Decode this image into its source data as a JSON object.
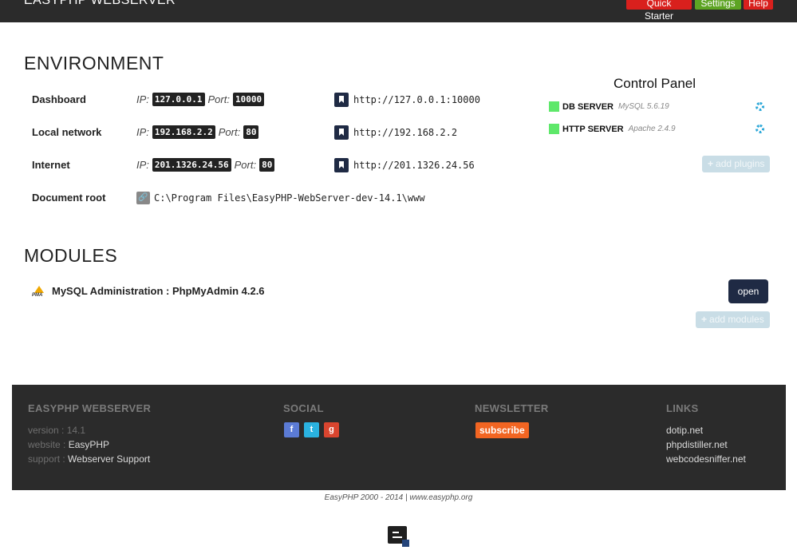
{
  "topbar": {
    "brand": "EASYPHP WEBSERVER",
    "quick_starter": "Quick Starter",
    "settings": "Settings",
    "help": "Help"
  },
  "environment": {
    "title": "ENVIRONMENT",
    "ip_label": "IP:",
    "port_label": "Port:",
    "rows": [
      {
        "label": "Dashboard",
        "ip": "127.0.0.1",
        "port": "10000",
        "url": "http://127.0.0.1:10000"
      },
      {
        "label": "Local network",
        "ip": "192.168.2.2",
        "port": "80",
        "url": "http://192.168.2.2"
      },
      {
        "label": "Internet",
        "ip": "201.1326.24.56",
        "port": "80",
        "url": "http://201.1326.24.56"
      }
    ],
    "docroot_label": "Document root",
    "docroot_path": "C:\\Program Files\\EasyPHP-WebServer-dev-14.1\\www"
  },
  "control_panel": {
    "title": "Control Panel",
    "servers": [
      {
        "name": "DB SERVER",
        "version": "MySQL 5.6.19",
        "status_color": "#5ee86a"
      },
      {
        "name": "HTTP SERVER",
        "version": "Apache 2.4.9",
        "status_color": "#5ee86a"
      }
    ],
    "add_plugins": "add plugins"
  },
  "modules": {
    "title": "MODULES",
    "items": [
      {
        "title": "MySQL Administration : PhpMyAdmin 4.2.6",
        "icon_text": "PMA",
        "action": "open"
      }
    ],
    "add_modules": "add modules"
  },
  "footer": {
    "col1": {
      "heading": "EASYPHP WEBSERVER",
      "version_label": "version :",
      "version_value": "14.1",
      "website_label": "website :",
      "website_value": "EasyPHP",
      "support_label": "support :",
      "support_value": "Webserver Support"
    },
    "social": {
      "heading": "SOCIAL",
      "facebook": "f",
      "twitter": "t",
      "google": "g"
    },
    "newsletter": {
      "heading": "NEWSLETTER",
      "subscribe": "subscribe"
    },
    "links": {
      "heading": "LINKS",
      "items": [
        "dotip.net",
        "phpdistiller.net",
        "webcodesniffer.net"
      ]
    }
  },
  "copyright": "EasyPHP 2000 - 2014 | www.easyphp.org",
  "colors": {
    "topbar_bg": "#2b2b2b",
    "red": "#d9201d",
    "green": "#5da423",
    "navy": "#1f2a44",
    "subscribe": "#f26522",
    "facebook": "#5b7bd5",
    "twitter": "#2ab2e0",
    "google": "#d9452f"
  }
}
